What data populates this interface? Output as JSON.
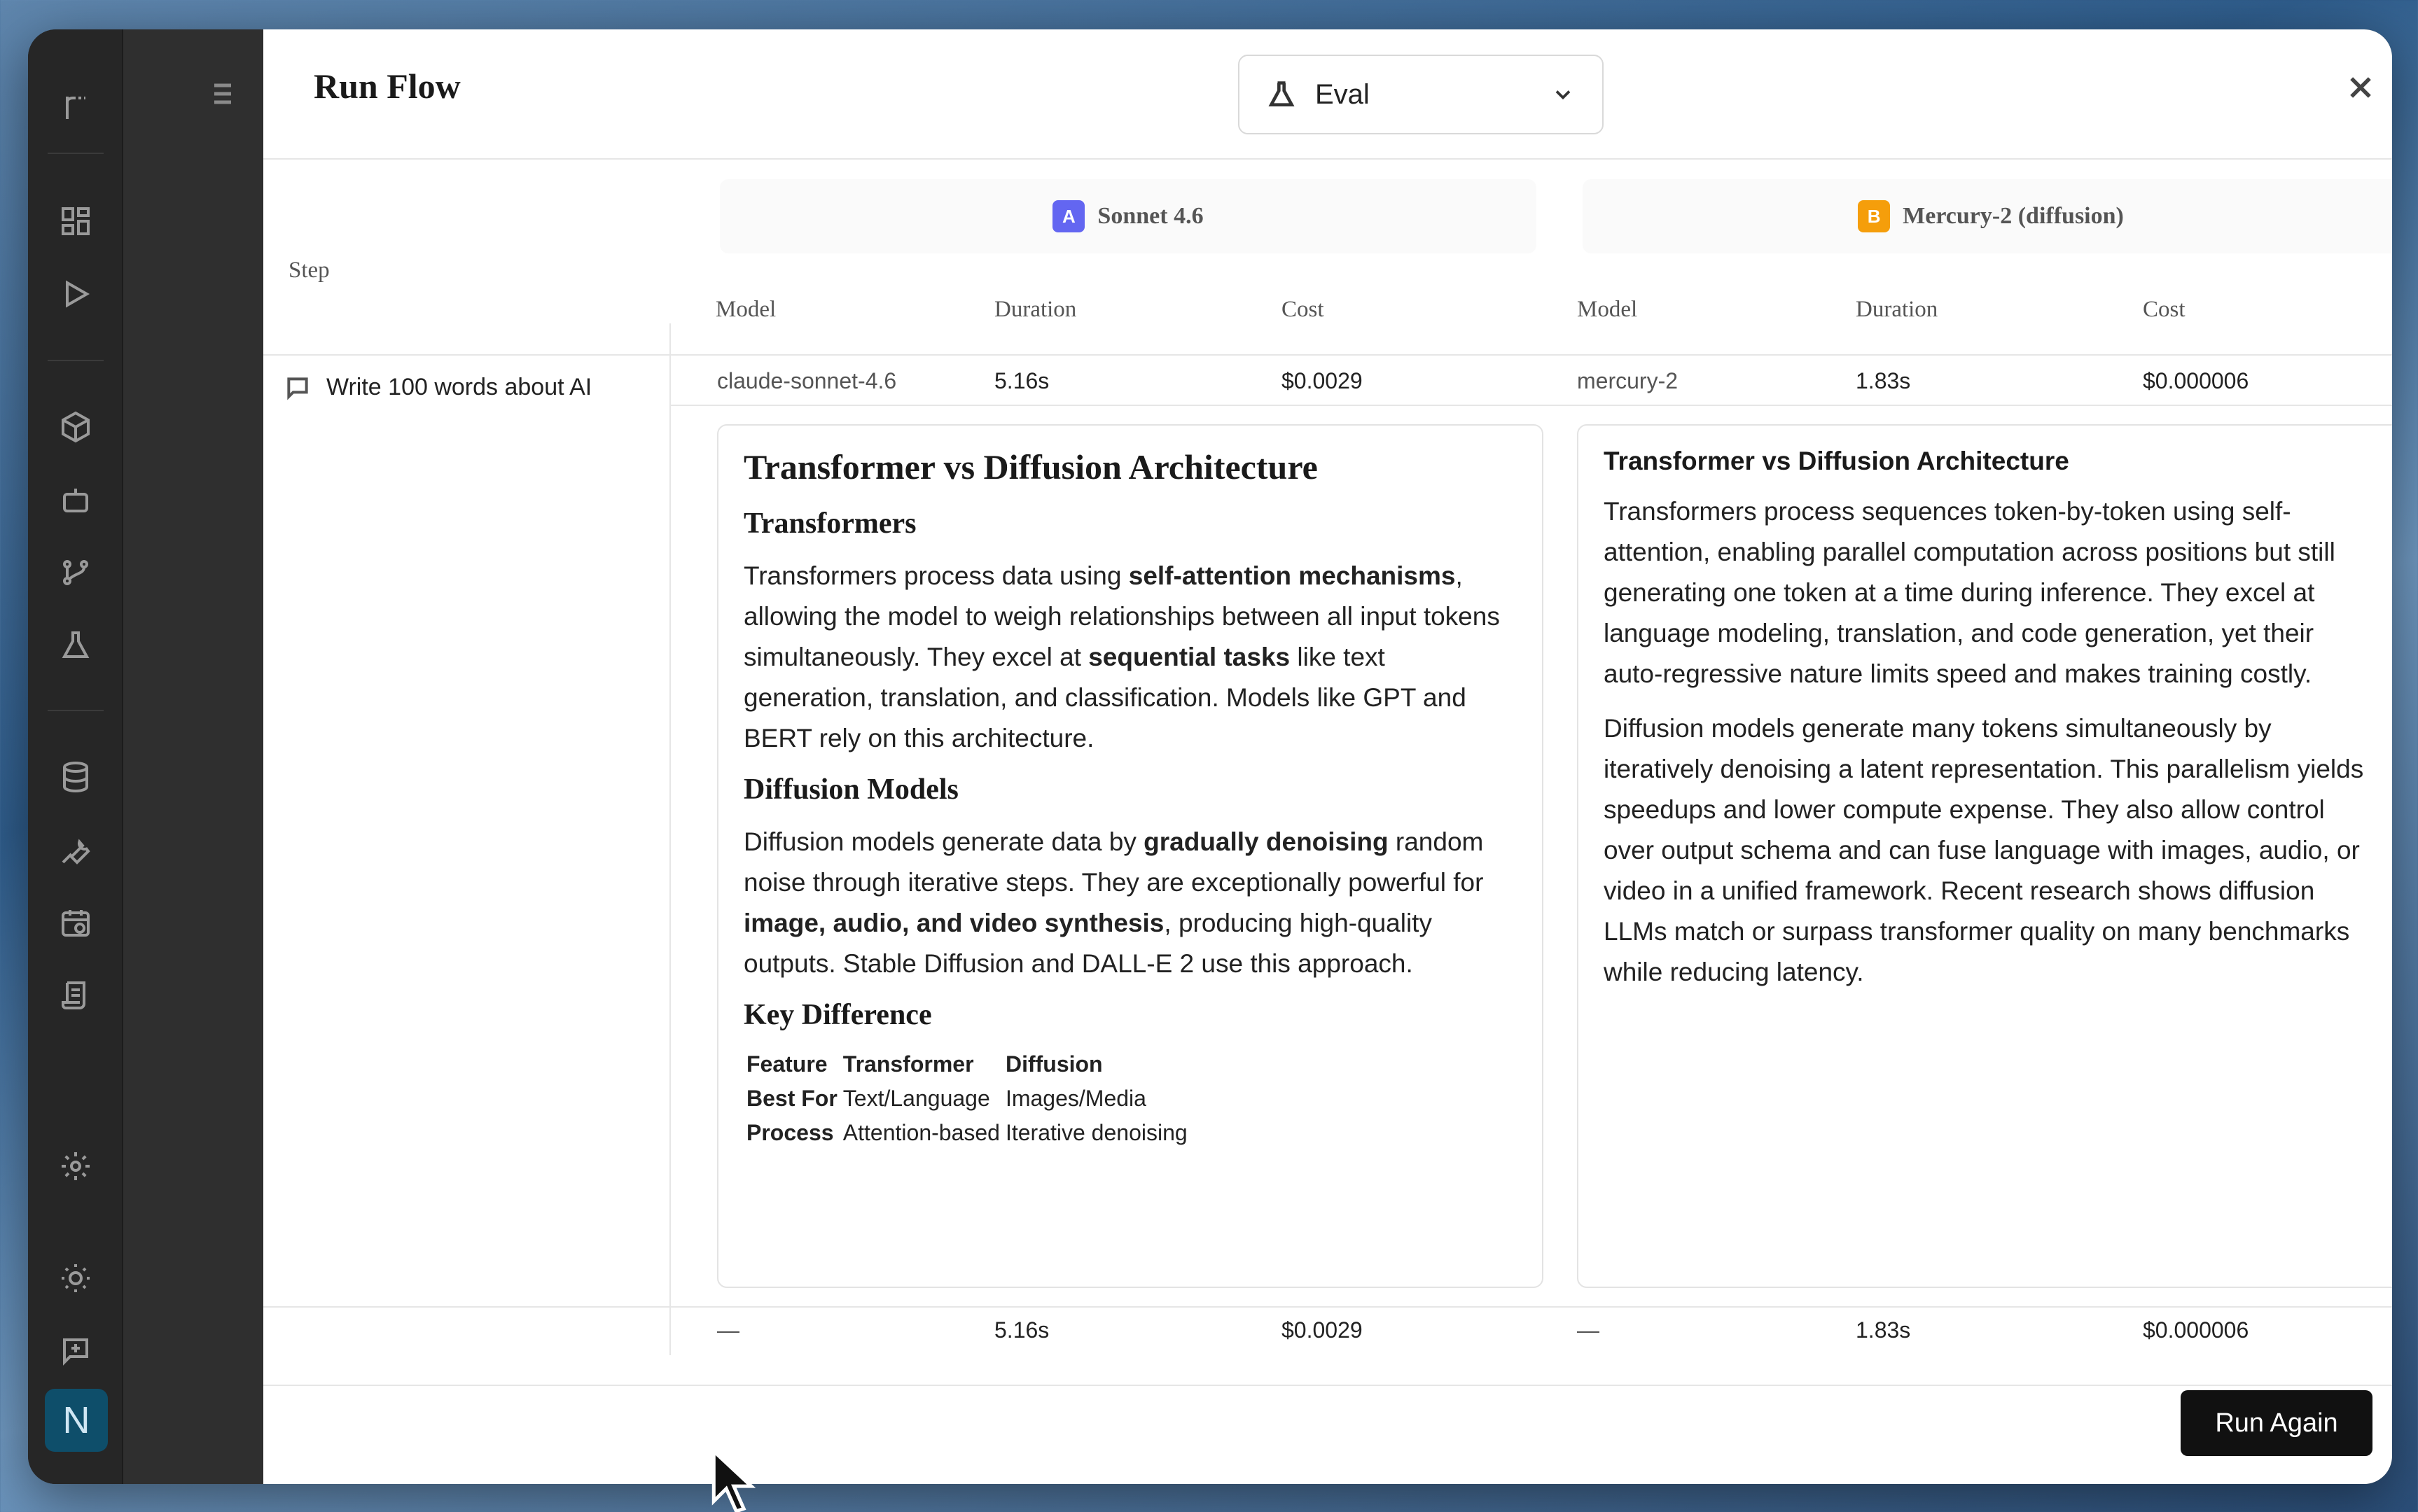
{
  "modal": {
    "title": "Run Flow",
    "mode_select": "Eval",
    "step_header": "Step"
  },
  "models": [
    {
      "badge": "A",
      "badge_color": "#6366f1",
      "name": "Sonnet 4.6"
    },
    {
      "badge": "B",
      "badge_color": "#f59e0b",
      "name": "Mercury-2 (diffusion)"
    }
  ],
  "columns": [
    "Model",
    "Duration",
    "Cost"
  ],
  "step": {
    "label": "Write 100 words about AI",
    "a": {
      "model": "claude-sonnet-4.6",
      "duration": "5.16s",
      "cost": "$0.0029"
    },
    "b": {
      "model": "mercury-2",
      "duration": "1.83s",
      "cost": "$0.000006"
    }
  },
  "output_a": {
    "h1": "Transformer vs Diffusion Architecture",
    "h2_1": "Transformers",
    "p1_pre": "Transformers process data using ",
    "p1_b1": "self-attention mechanisms",
    "p1_mid": ", allowing the model to weigh relationships between all input tokens simultaneously. They excel at ",
    "p1_b2": "sequential tasks",
    "p1_post": " like text generation, translation, and classification. Models like GPT and BERT rely on this architecture.",
    "h2_2": "Diffusion Models",
    "p2_pre": "Diffusion models generate data by ",
    "p2_b1": "gradually denoising",
    "p2_mid": " random noise through iterative steps. They are exceptionally powerful for ",
    "p2_b2": "image, audio, and video synthesis",
    "p2_post": ", producing high-quality outputs. Stable Diffusion and DALL-E 2 use this approach.",
    "h2_3": "Key Difference",
    "table": {
      "headers": [
        "Feature",
        "Transformer",
        "Diffusion"
      ],
      "rows": [
        [
          "Best For",
          "Text/Language",
          "Images/Media"
        ],
        [
          "Process",
          "Attention-based",
          "Iterative denoising"
        ]
      ]
    }
  },
  "output_b": {
    "h": "Transformer vs Diffusion Architecture",
    "p1": "Transformers process sequences token-by-token using self-attention, enabling parallel computation across positions but still generating one token at a time during inference. They excel at language modeling, translation, and code generation, yet their auto-regressive nature limits speed and makes training costly.",
    "p2": "Diffusion models generate many tokens simultaneously by iteratively denoising a latent representation. This parallelism yields speedups and lower compute expense. They also allow control over output schema and can fuse language with images, audio, or video in a unified framework. Recent research shows diffusion LLMs match or surpass transformer quality on many benchmarks while reducing latency."
  },
  "totals": {
    "a": {
      "model": "—",
      "duration": "5.16s",
      "cost": "$0.0029"
    },
    "b": {
      "model": "—",
      "duration": "1.83s",
      "cost": "$0.000006"
    }
  },
  "footer": {
    "run_again": "Run Again"
  },
  "sidebar": {
    "avatar": "N"
  }
}
